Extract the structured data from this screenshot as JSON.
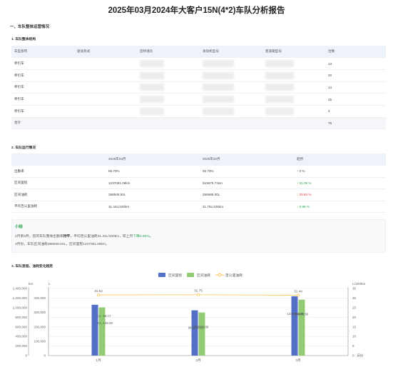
{
  "report_title": "2025年03月2024年大客户15N(4*2)车队分析报告",
  "section1_title": "一、车队整体运营情况",
  "sub1_title": "1. 车队整体结构",
  "table1": {
    "headers": [
      "车型系列",
      "驱动形式",
      "后桥速比",
      "发动机型号",
      "变速箱型号",
      "台数"
    ],
    "rows": [
      {
        "series": "牵引车",
        "count": "13"
      },
      {
        "series": "牵引车",
        "count": "20"
      },
      {
        "series": "牵引车",
        "count": "14"
      },
      {
        "series": "牵引车",
        "count": "25"
      },
      {
        "series": "牵引车",
        "count": "4"
      }
    ],
    "total_label": "合计",
    "total_count": "76"
  },
  "sub2_title": "2. 车队运行情况",
  "table2": {
    "headers": [
      "",
      "2025年03月",
      "2025年02月",
      "趋势"
    ],
    "rows": [
      {
        "label": "出勤率",
        "cur": "65.79%",
        "prev": "65.79%",
        "trend": "0 %",
        "dir": "flat"
      },
      {
        "label": "区间里程",
        "cur": "1237081.08km",
        "prev": "943675.71km",
        "trend": "31.09 %",
        "dir": "up"
      },
      {
        "label": "区间油耗",
        "cur": "388948.50L",
        "prev": "299588.00L",
        "trend": "29.83 %",
        "dir": "down"
      },
      {
        "label": "平均百公里油耗",
        "cur": "31.44L/100km",
        "prev": "31.75L/100km",
        "trend": "0.98 %",
        "dir": "up"
      }
    ]
  },
  "summary": {
    "heading": "小结",
    "line1_a": "2月到3月，您的车队整体出勤率",
    "line1_b": "持平",
    "line1_c": "，平均百公里油耗31.44L/100km，较上月",
    "line1_d": "下降0.98%",
    "line1_e": "。",
    "line2": "3月份，车队区间油耗388948.50L，区间里程1237081.08km。"
  },
  "sub3_title": "3. 车队里程、油耗变化趋势",
  "colors": {
    "mileage": "#5470c6",
    "fuel": "#91cc75",
    "avg": "#fac858",
    "up": "#2fa44f",
    "down": "#e64242"
  },
  "chart_data": {
    "type": "bar",
    "categories": [
      "1月",
      "2月",
      "3月"
    ],
    "series": [
      {
        "name": "区间里程",
        "axis": "left",
        "values": [
          1060000,
          943675.71,
          1237081.08
        ],
        "labels": [
          "",
          "943675.71",
          "1237081.08"
        ]
      },
      {
        "name": "区间油耗",
        "axis": "middle",
        "values": [
          335000,
          299588.0,
          388948.5
        ],
        "labels": [
          "",
          "299588.00",
          "388948.50"
        ]
      },
      {
        "name": "百公里油耗",
        "axis": "right",
        "type": "line",
        "values": [
          31.62,
          31.75,
          31.44
        ],
        "labels": [
          "31.62",
          "31.75",
          "31.44"
        ]
      }
    ],
    "partial_labels": [
      "10...64.17",
      "33...128.00"
    ],
    "left_axis": {
      "unit": "km",
      "ticks": [
        "0",
        "200,000",
        "400,000",
        "600,000",
        "800,000",
        "1,000,000",
        "1,200,000",
        "1,400,000"
      ],
      "range": [
        0,
        1400000
      ]
    },
    "middle_axis": {
      "unit": "L",
      "ticks": [
        "0",
        "100,000",
        "200,000",
        "300,000",
        "400,000"
      ],
      "range": [
        0,
        466667
      ]
    },
    "right_axis": {
      "unit": "L/100km",
      "ticks": [
        "0",
        "5",
        "10",
        "15",
        "20",
        "25",
        "30",
        "35"
      ],
      "range": [
        0,
        35
      ]
    },
    "x_unit": "月份",
    "legend_position": "top"
  }
}
